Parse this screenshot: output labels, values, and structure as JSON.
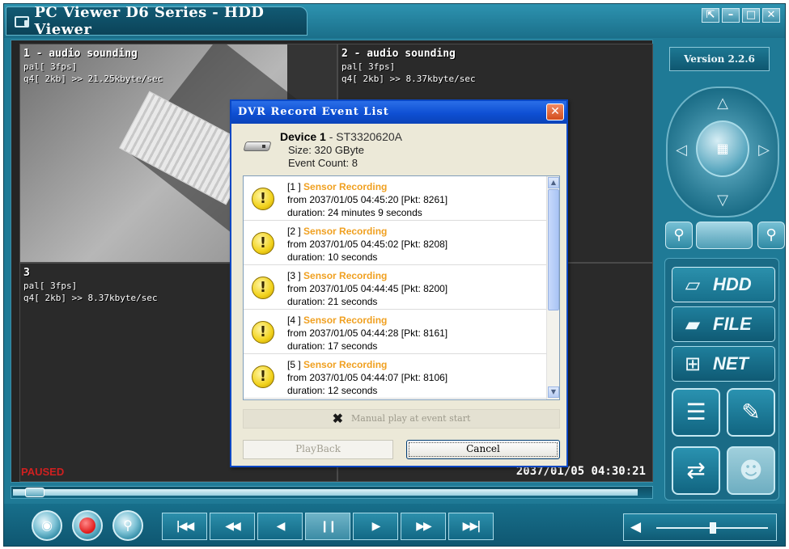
{
  "window": {
    "title": "PC Viewer D6 Series - HDD Viewer",
    "controls": [
      "⇱",
      "–",
      "□",
      "✕"
    ]
  },
  "version": "Version 2.2.6",
  "cameras": [
    {
      "title": "1 - audio sounding",
      "line1": "pal[ 3fps]",
      "line2": "q4[ 2kb] >> 21.25kbyte/sec"
    },
    {
      "title": "2 - audio sounding",
      "line1": "pal[ 3fps]",
      "line2": "q4[ 2kb] >> 8.37kbyte/sec"
    },
    {
      "title": "3",
      "line1": "pal[ 3fps]",
      "line2": "q4[ 2kb] >> 8.37kbyte/sec"
    }
  ],
  "status": {
    "paused": "PAUSED",
    "timestamp": "2037/01/05 04:30:21"
  },
  "dialog": {
    "title": "DVR Record Event List",
    "device_label": "Device 1",
    "device_model": " - ST3320620A",
    "size": "Size: 320 GByte",
    "event_count": "Event Count: 8",
    "events": [
      {
        "index": "[1 ]",
        "type": "Sensor Recording",
        "from": "from 2037/01/05 04:45:20 [Pkt: 8261]",
        "duration": "duration: 24 minutes 9 seconds"
      },
      {
        "index": "[2 ]",
        "type": "Sensor Recording",
        "from": "from 2037/01/05 04:45:02 [Pkt: 8208]",
        "duration": "duration: 10 seconds"
      },
      {
        "index": "[3 ]",
        "type": "Sensor Recording",
        "from": "from 2037/01/05 04:44:45 [Pkt: 8200]",
        "duration": "duration: 21 seconds"
      },
      {
        "index": "[4 ]",
        "type": "Sensor Recording",
        "from": "from 2037/01/05 04:44:28 [Pkt: 8161]",
        "duration": "duration: 17 seconds"
      },
      {
        "index": "[5 ]",
        "type": "Sensor Recording",
        "from": "from 2037/01/05 04:44:07 [Pkt: 8106]",
        "duration": "duration: 12 seconds"
      }
    ],
    "manual_play": "Manual play at event start",
    "playback_label": "PlayBack",
    "cancel_label": "Cancel"
  },
  "modes": {
    "hdd": "HDD",
    "file": "FILE",
    "net": "NET"
  },
  "progress": {
    "position_fraction": 0.02
  },
  "volume": {
    "level_fraction": 0.48
  }
}
